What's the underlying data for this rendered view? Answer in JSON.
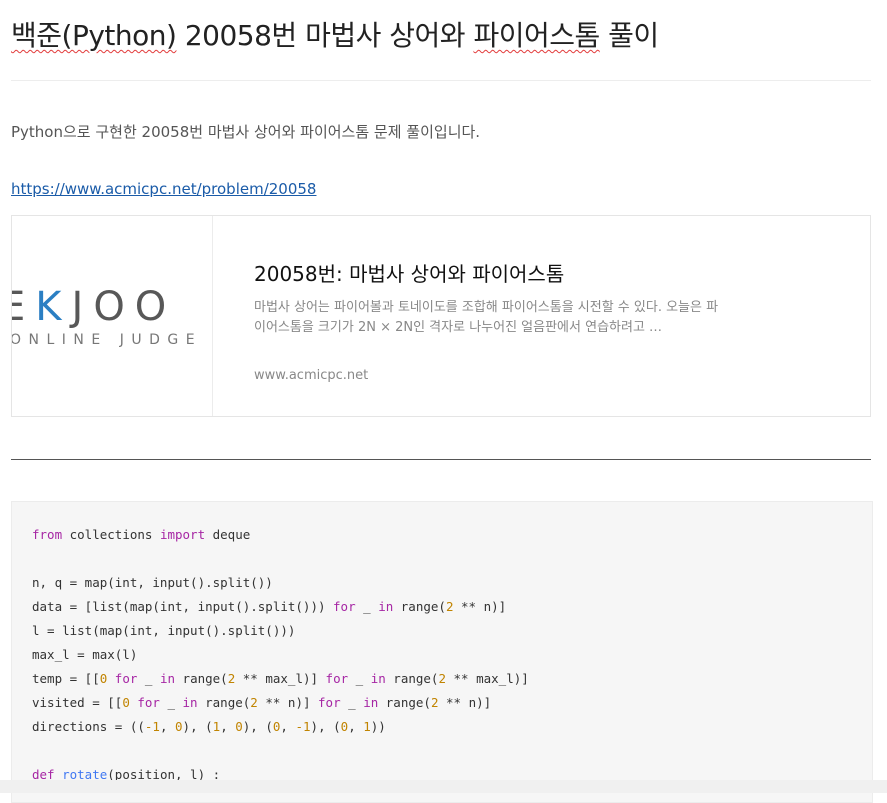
{
  "title": {
    "part1": "백준(Python)",
    "part2": " 20058번 마법사 상어와 ",
    "part3": "파이어스톰",
    "part4": " 풀이"
  },
  "intro": "Python으로 구현한 20058번 마법사 상어와 파이어스톰 문제 풀이입니다.",
  "link": "https://www.acmicpc.net/problem/20058",
  "card": {
    "logo_left": "E",
    "logo_accent": "K",
    "logo_right": "JOO",
    "logo_sub": "ONLINE JUDGE",
    "title": "20058번: 마법사 상어와 파이어스톰",
    "description": "마법사 상어는 파이어볼과 토네이도를 조합해 파이어스톰을 시전할 수 있다. 오늘은 파이어스톰을 크기가 2N × 2N인 격자로 나누어진 얼음판에서 연습하려고 …",
    "url": "www.acmicpc.net"
  },
  "code": {
    "l1": [
      "from",
      " collections ",
      "import",
      " deque"
    ],
    "l2": "n, q = map(int, input().split())",
    "l3": [
      "data = [list(map(int, input().split())) ",
      "for",
      " _ ",
      "in",
      " range(",
      "2",
      " ** n)]"
    ],
    "l4": "l = list(map(int, input().split()))",
    "l5": "max_l = max(l)",
    "l6": [
      "temp = [[",
      "0",
      " ",
      "for",
      " _ ",
      "in",
      " range(",
      "2",
      " ** max_l)] ",
      "for",
      " _ ",
      "in",
      " range(",
      "2",
      " ** max_l)]"
    ],
    "l7": [
      "visited = [[",
      "0",
      " ",
      "for",
      " _ ",
      "in",
      " range(",
      "2",
      " ** n)] ",
      "for",
      " _ ",
      "in",
      " range(",
      "2",
      " ** n)]"
    ],
    "l8": [
      "directions = ((",
      "-1",
      ", ",
      "0",
      "), (",
      "1",
      ", ",
      "0",
      "), (",
      "0",
      ", ",
      "-1",
      "), (",
      "0",
      ", ",
      "1",
      "))"
    ],
    "l9": [
      "def",
      " ",
      "rotate",
      "(position, l) :"
    ]
  }
}
